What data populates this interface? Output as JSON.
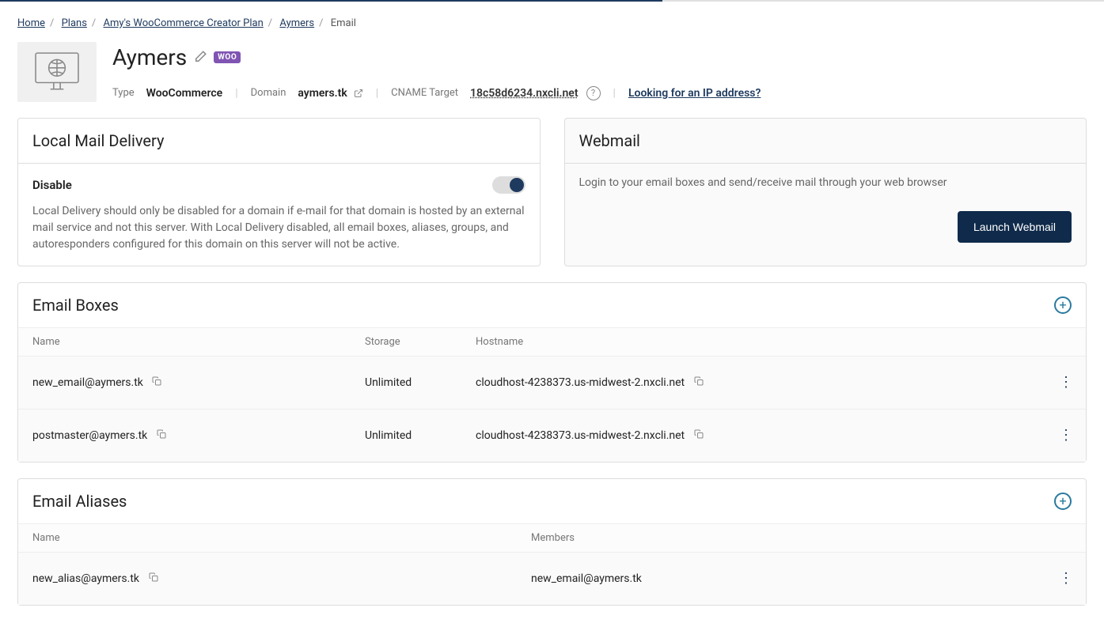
{
  "breadcrumb": {
    "home": "Home",
    "plans": "Plans",
    "plan": "Amy's WooCommerce Creator Plan",
    "site": "Aymers",
    "current": "Email"
  },
  "header": {
    "title": "Aymers",
    "woo_badge": "WOO",
    "type_label": "Type",
    "type_value": "WooCommerce",
    "domain_label": "Domain",
    "domain_value": "aymers.tk",
    "cname_label": "CNAME Target",
    "cname_value": "18c58d6234.nxcli.net",
    "help_q": "?",
    "ip_link": "Looking for an IP address?"
  },
  "local_mail": {
    "title": "Local Mail Delivery",
    "toggle_label": "Disable",
    "desc": "Local Delivery should only be disabled for a domain if e-mail for that domain is hosted by an external mail service and not this server. With Local Delivery disabled, all email boxes, aliases, groups, and autoresponders configured for this domain on this server will not be active."
  },
  "webmail": {
    "title": "Webmail",
    "desc": "Login to your email boxes and send/receive mail through your web browser",
    "button": "Launch Webmail"
  },
  "email_boxes": {
    "title": "Email Boxes",
    "col_name": "Name",
    "col_storage": "Storage",
    "col_hostname": "Hostname",
    "rows": [
      {
        "name": "new_email@aymers.tk",
        "storage": "Unlimited",
        "host": "cloudhost-4238373.us-midwest-2.nxcli.net"
      },
      {
        "name": "postmaster@aymers.tk",
        "storage": "Unlimited",
        "host": "cloudhost-4238373.us-midwest-2.nxcli.net"
      }
    ]
  },
  "email_aliases": {
    "title": "Email Aliases",
    "col_name": "Name",
    "col_members": "Members",
    "rows": [
      {
        "name": "new_alias@aymers.tk",
        "members": "new_email@aymers.tk"
      }
    ]
  }
}
